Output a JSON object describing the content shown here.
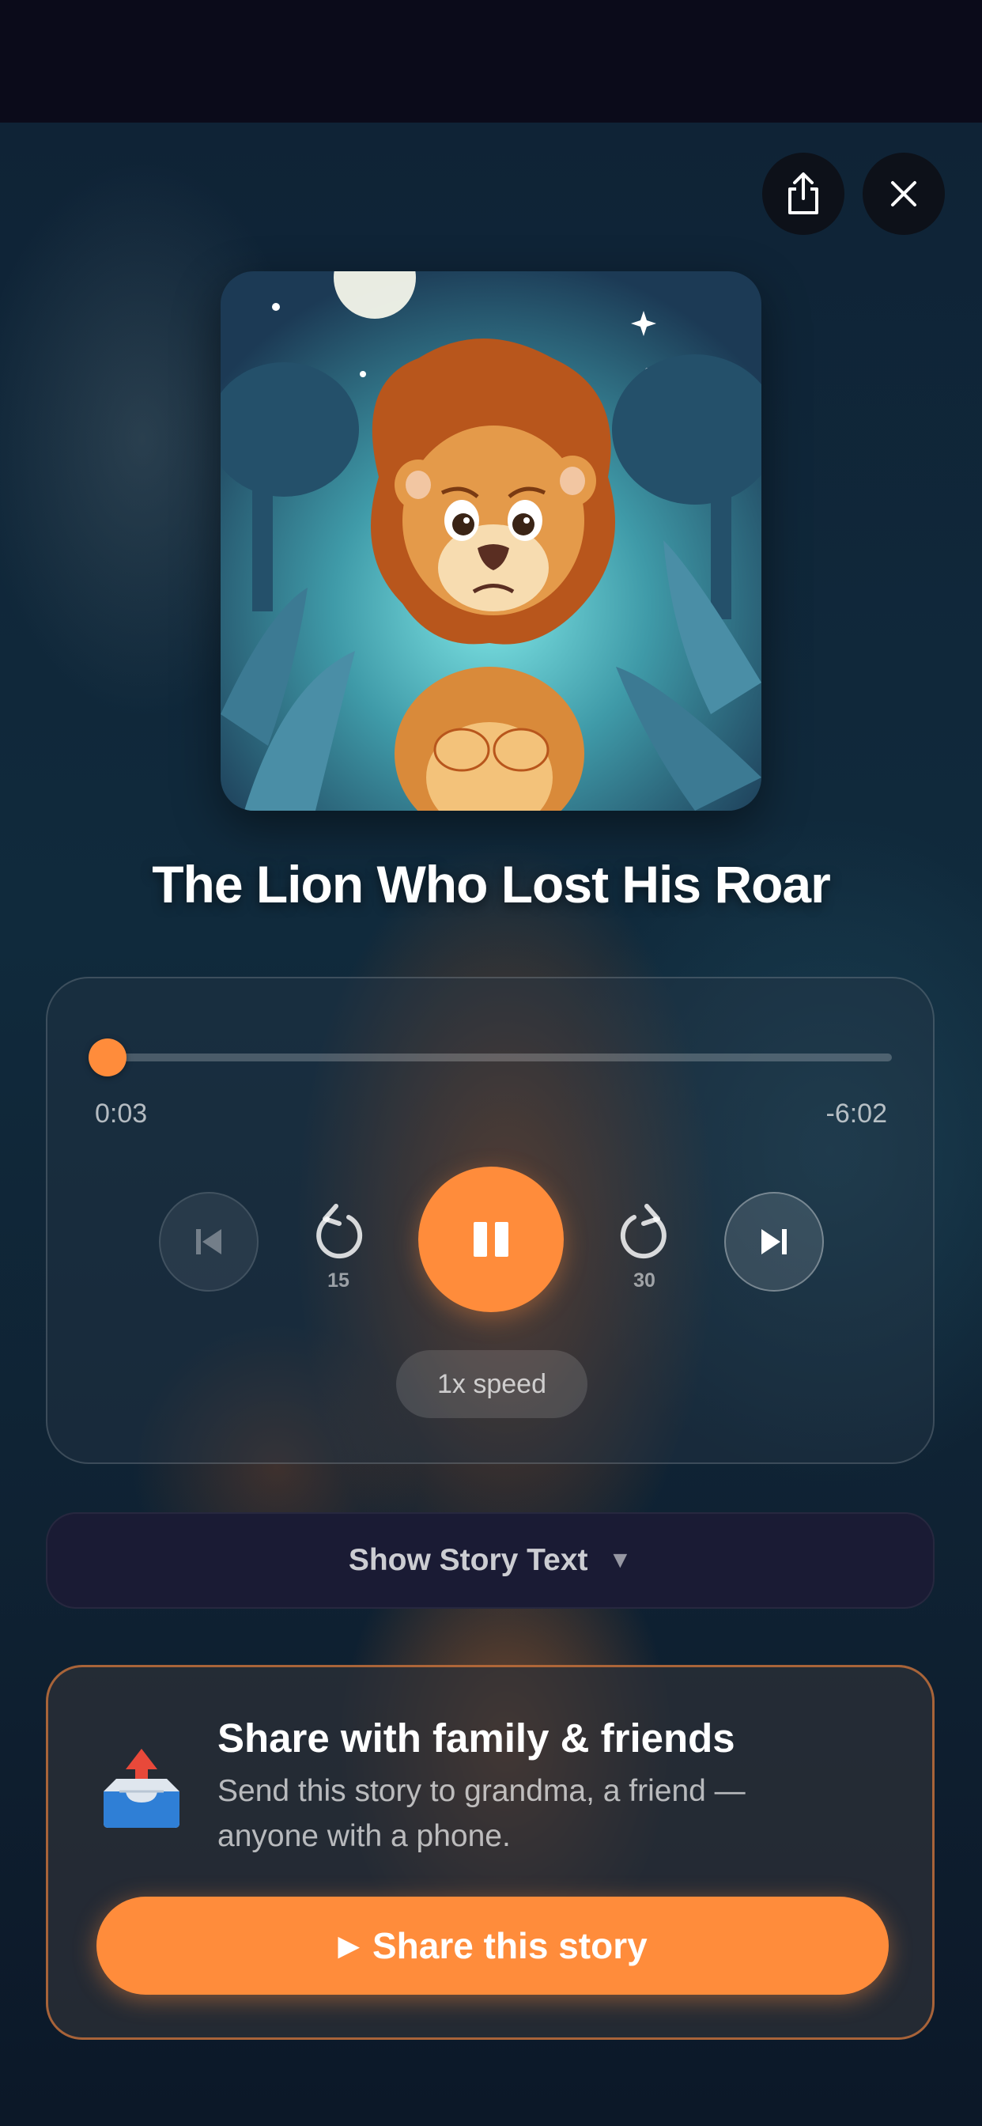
{
  "header": {
    "share_icon": "share-icon",
    "close_icon": "close-icon"
  },
  "story": {
    "title": "The Lion Who Lost His Roar",
    "cover_description_icon": "lion-illustration"
  },
  "player": {
    "elapsed": "0:03",
    "remaining": "-6:02",
    "progress_fraction": 0.008,
    "skip_back_seconds": "15",
    "skip_forward_seconds": "30",
    "speed_label": "1x speed",
    "state": "playing",
    "accent_color": "#ff8c3b"
  },
  "story_text_toggle": {
    "label": "Show Story Text",
    "caret": "▼"
  },
  "share_card": {
    "icon": "outbox-tray-icon",
    "title": "Share with family & friends",
    "subtitle": "Send this story to grandma, a friend — anyone with a phone.",
    "button_glyph": "▶",
    "button_label": "Share this story"
  }
}
